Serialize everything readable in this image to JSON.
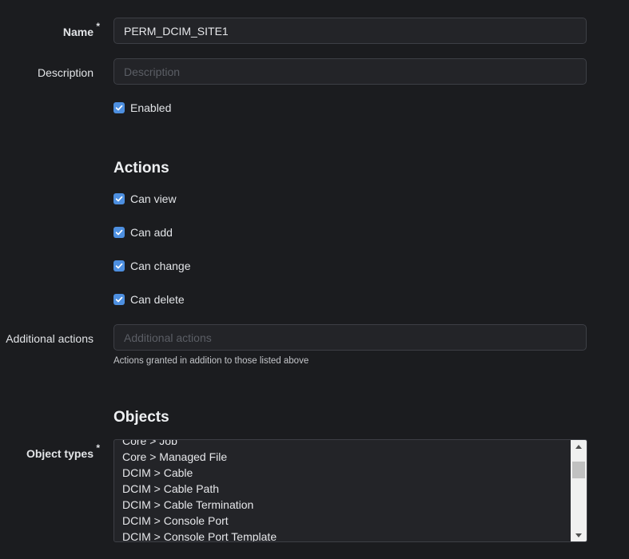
{
  "form": {
    "name": {
      "label": "Name",
      "required_mark": "*",
      "value": "PERM_DCIM_SITE1"
    },
    "description": {
      "label": "Description",
      "placeholder": "Description",
      "value": ""
    },
    "enabled": {
      "label": "Enabled",
      "checked": true
    }
  },
  "actions": {
    "title": "Actions",
    "checkboxes": [
      {
        "label": "Can view",
        "checked": true
      },
      {
        "label": "Can add",
        "checked": true
      },
      {
        "label": "Can change",
        "checked": true
      },
      {
        "label": "Can delete",
        "checked": true
      }
    ],
    "additional": {
      "label": "Additional actions",
      "placeholder": "Additional actions",
      "help": "Actions granted in addition to those listed above"
    }
  },
  "objects": {
    "title": "Objects",
    "object_types": {
      "label": "Object types",
      "required_mark": "*",
      "options": [
        "Core > Job",
        "Core > Managed File",
        "DCIM > Cable",
        "DCIM > Cable Path",
        "DCIM > Cable Termination",
        "DCIM > Console Port",
        "DCIM > Console Port Template"
      ]
    }
  },
  "colors": {
    "background": "#1b1c1f",
    "input_bg": "#232428",
    "checkbox_accent": "#4d8fe0"
  }
}
